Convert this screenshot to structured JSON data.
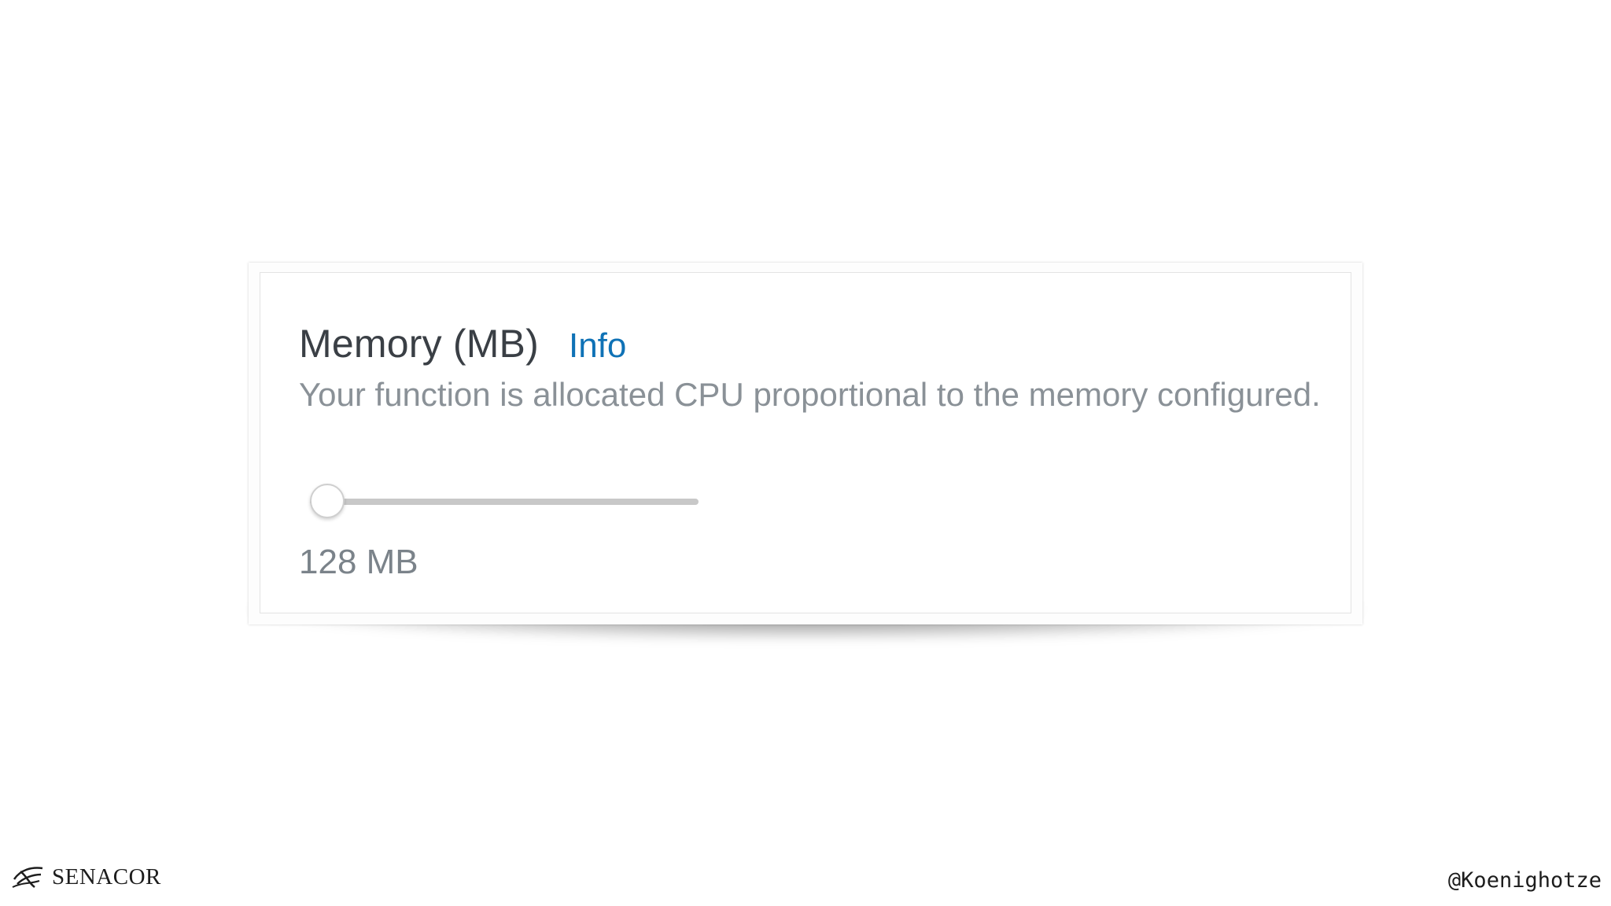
{
  "memory_setting": {
    "title": "Memory (MB)",
    "info_label": "Info",
    "description": "Your function is allocated CPU proportional to the memory configured.",
    "value_label": "128 MB",
    "slider_fraction": 0.0,
    "accent_color": "#0f72b6"
  },
  "footer": {
    "brand_name": "SENACOR",
    "brand_logo_icon": "senacor-logo-icon",
    "handle": "@Koenighotze"
  }
}
